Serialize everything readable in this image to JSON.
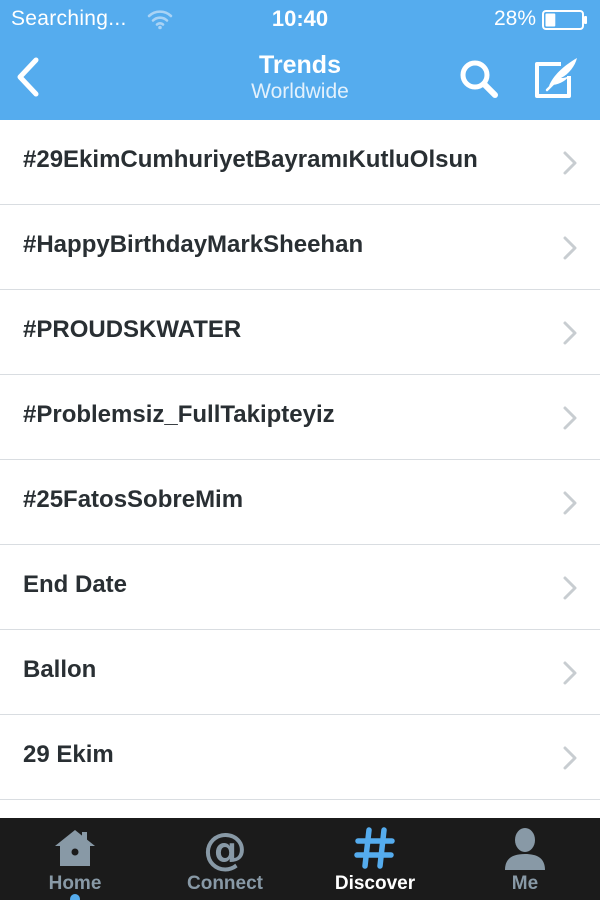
{
  "status_bar": {
    "carrier": "Searching...",
    "time": "10:40",
    "battery_percent": "28%",
    "wifi_icon": "wifi-icon",
    "battery_icon": "battery-icon",
    "battery_level": 0.28
  },
  "nav": {
    "title": "Trends",
    "subtitle": "Worldwide",
    "back_icon": "chevron-left-icon",
    "search_icon": "search-icon",
    "compose_icon": "compose-icon"
  },
  "trends": [
    "#29EkimCumhuriyetBayramıKutluOlsun",
    "#HappyBirthdayMarkSheehan",
    "#PROUDSKWATER",
    "#Problemsiz_FullTakipteyiz",
    "#25FatosSobreMim",
    "End Date",
    "Ballon",
    "29 Ekim"
  ],
  "tabs": [
    {
      "label": "Home",
      "icon": "home-icon",
      "active": false
    },
    {
      "label": "Connect",
      "icon": "at-icon",
      "active": false
    },
    {
      "label": "Discover",
      "icon": "hashtag-icon",
      "active": true
    },
    {
      "label": "Me",
      "icon": "person-icon",
      "active": false
    }
  ],
  "colors": {
    "header_bg": "#55acee",
    "tab_bar_bg": "#1b1b1b",
    "active_tab_icon": "#55acee",
    "inactive_tab": "#8899a6",
    "trend_text": "#292f33",
    "divider": "#d9dde1"
  }
}
